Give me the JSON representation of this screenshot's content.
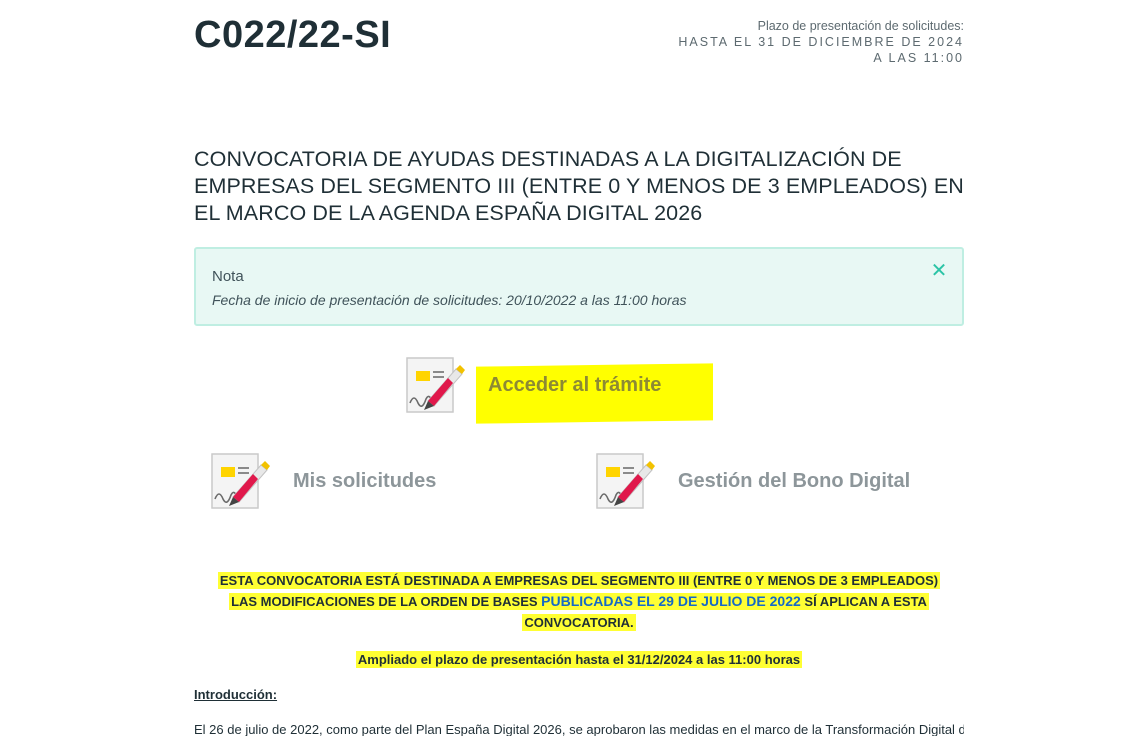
{
  "header": {
    "code": "C022/22-SI",
    "deadline_label": "Plazo de presentación de solicitudes:",
    "deadline_line1": "HASTA EL 31 DE DICIEMBRE DE 2024",
    "deadline_line2": "A LAS 11:00"
  },
  "title": "CONVOCATORIA DE AYUDAS DESTINADAS A LA DIGITALIZACIÓN DE EMPRESAS DEL SEGMENTO III (ENTRE 0 Y MENOS DE 3 EMPLEADOS) EN EL MARCO DE LA AGENDA ESPAÑA DIGITAL 2026",
  "note": {
    "heading": "Nota",
    "text": "Fecha de inicio de presentación de solicitudes: 20/10/2022 a las 11:00 horas",
    "close_symbol": "✕"
  },
  "actions": {
    "access": "Acceder al trámite",
    "my_requests": "Mis solicitudes",
    "bono": "Gestión del Bono Digital"
  },
  "notices": {
    "line1": "ESTA CONVOCATORIA ESTÁ DESTINADA A EMPRESAS DEL SEGMENTO III (ENTRE 0 Y MENOS DE 3 EMPLEADOS)",
    "line2_prefix": "LAS MODIFICACIONES DE LA ORDEN DE BASES ",
    "line2_link": "PUBLICADAS EL 29 DE JULIO DE 2022",
    "line2_suffix": " SÍ APLICAN A ESTA",
    "line3": "CONVOCATORIA.",
    "extended": "Ampliado el plazo de presentación hasta el 31/12/2024 a las 11:00 horas"
  },
  "intro_heading": "Introducción:",
  "intro_text_partial": "El 26 de julio de 2022, como parte del Plan España Digital 2026, se aprobaron las medidas en el marco de la Transformación Digital de"
}
